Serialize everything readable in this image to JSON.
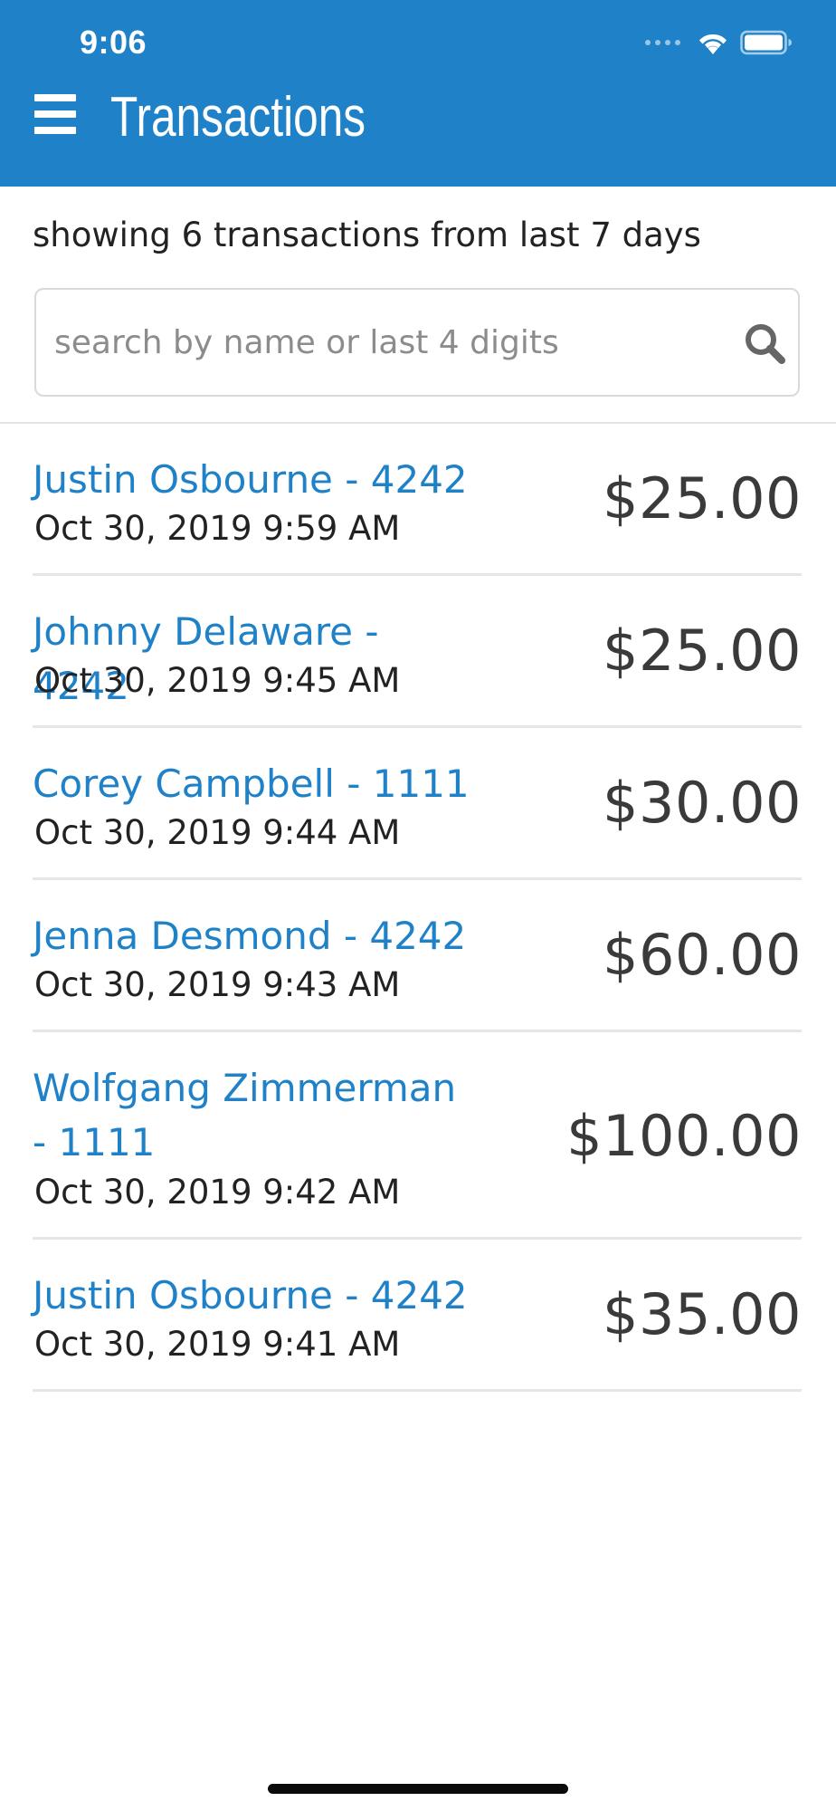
{
  "status_bar": {
    "time": "9:06",
    "icons": [
      "signal-icon",
      "wifi-icon",
      "battery-icon"
    ]
  },
  "header": {
    "title": "Transactions",
    "menu_icon": "hamburger-menu-icon"
  },
  "summary": "showing 6 transactions from last 7 days",
  "search": {
    "placeholder": "search by name or last 4 digits",
    "value": "",
    "icon": "search-icon"
  },
  "transactions": [
    {
      "name": "Justin Osbourne - 4242",
      "date": "Oct 30, 2019 9:59 AM",
      "amount": "$25.00"
    },
    {
      "name": "Johnny Delaware - 4242",
      "date": "Oct 30, 2019 9:45 AM",
      "amount": "$25.00"
    },
    {
      "name": "Corey Campbell - 1111",
      "date": "Oct 30, 2019 9:44 AM",
      "amount": "$30.00"
    },
    {
      "name": "Jenna Desmond - 4242",
      "date": "Oct 30, 2019 9:43 AM",
      "amount": "$60.00"
    },
    {
      "name": "Wolfgang Zimmerman - 1111",
      "date": "Oct 30, 2019 9:42 AM",
      "amount": "$100.00"
    },
    {
      "name": "Justin Osbourne - 4242",
      "date": "Oct 30, 2019 9:41 AM",
      "amount": "$35.00"
    }
  ],
  "colors": {
    "header_background": "#1f82c8",
    "link_blue": "#1f82c8",
    "text_dark": "#222222",
    "amount_text": "#3a3a3a",
    "divider": "#e6e6e6"
  }
}
